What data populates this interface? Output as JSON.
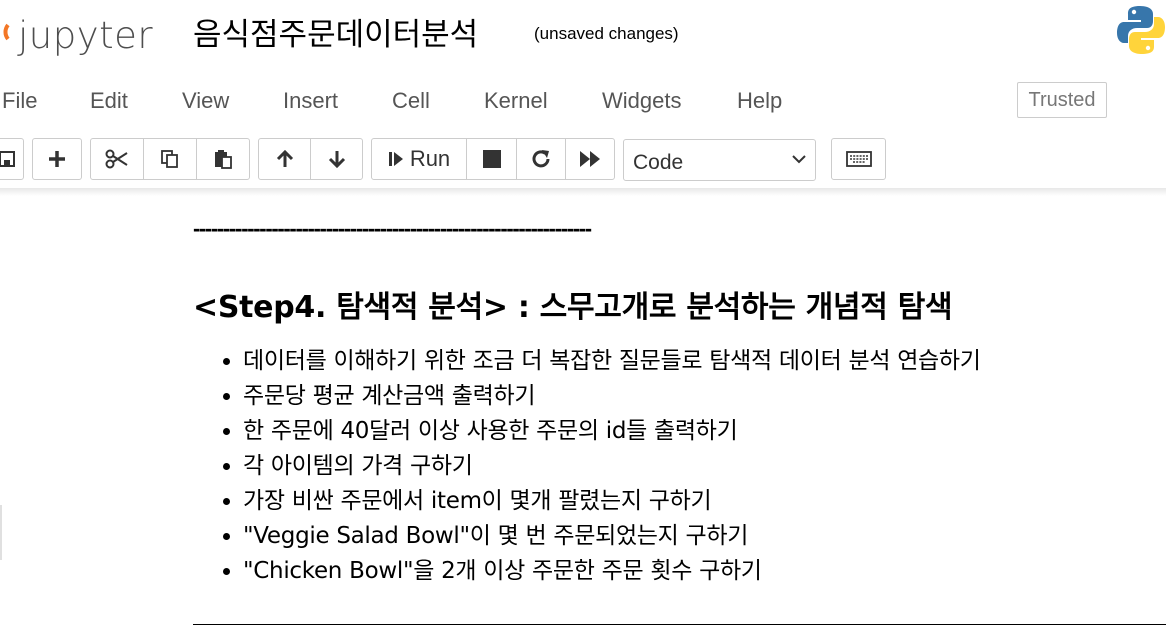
{
  "header": {
    "logo_text": "jupyter",
    "notebook_title": "음식점주문데이터분석",
    "save_status": "(unsaved changes)"
  },
  "menu": {
    "items": [
      "File",
      "Edit",
      "View",
      "Insert",
      "Cell",
      "Kernel",
      "Widgets",
      "Help"
    ],
    "trusted_label": "Trusted"
  },
  "toolbar": {
    "run_label": "Run",
    "cell_type": "Code",
    "icons": [
      "save-icon",
      "plus-icon",
      "scissors-icon",
      "copy-icon",
      "paste-icon",
      "arrow-up-icon",
      "arrow-down-icon",
      "run-icon",
      "stop-icon",
      "restart-icon",
      "fast-forward-icon",
      "keyboard-icon"
    ]
  },
  "cell": {
    "dashes": "------------------------------------------------------------------",
    "heading": "<Step4. 탐색적 분석> : 스무고개로 분석하는 개념적 탐색",
    "bullets": [
      "데이터를 이해하기 위한 조금 더 복잡한 질문들로 탐색적 데이터 분석 연습하기",
      "주문당 평균 계산금액 출력하기",
      "한 주문에 40달러 이상 사용한 주문의 id들 출력하기",
      "각 아이템의 가격 구하기",
      "가장 비싼 주문에서 item이 몇개 팔렸는지 구하기",
      "\"Veggie Salad Bowl\"이 몇 번 주문되었는지 구하기",
      "\"Chicken Bowl\"을 2개 이상 주문한 주문 횟수 구하기"
    ]
  },
  "colors": {
    "logo_orange": "#f37726",
    "python_blue": "#3776ab",
    "python_yellow": "#ffd43b"
  }
}
